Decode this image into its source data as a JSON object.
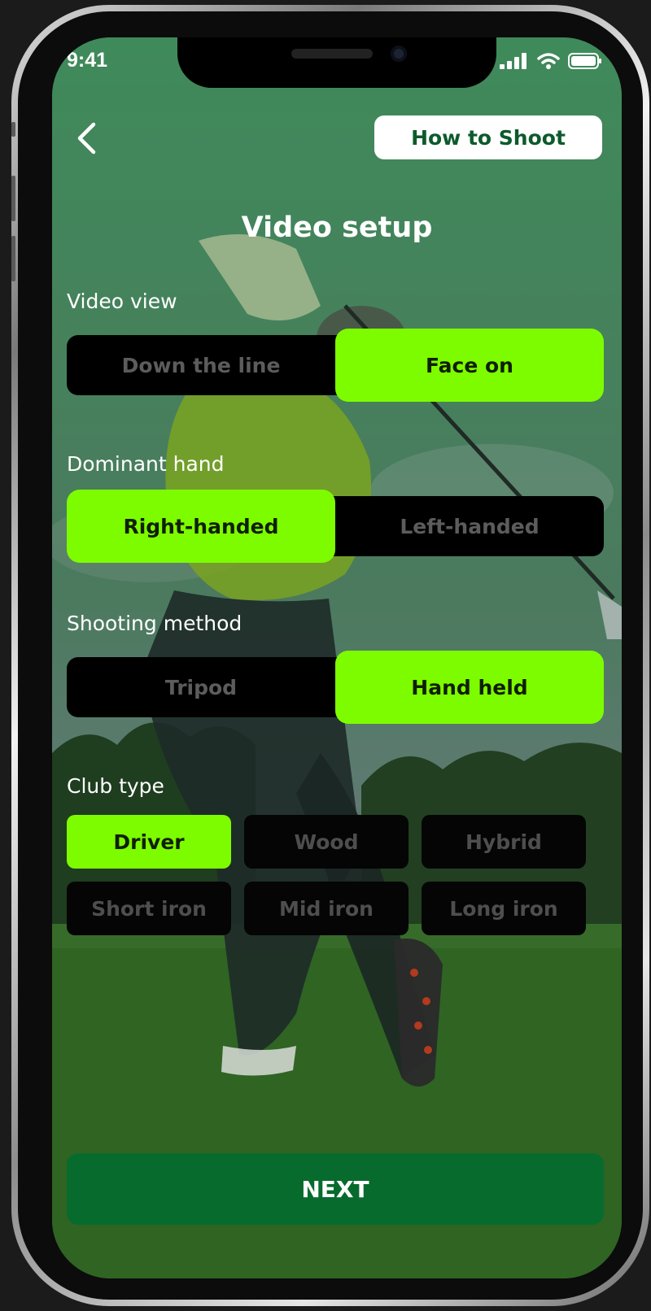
{
  "status": {
    "time": "9:41"
  },
  "header": {
    "how_to_label": "How to Shoot"
  },
  "page": {
    "title": "Video setup"
  },
  "video_view": {
    "label": "Video view",
    "options": [
      "Down the line",
      "Face on"
    ],
    "selected": "Face on"
  },
  "dominant_hand": {
    "label": "Dominant hand",
    "options": [
      "Right-handed",
      "Left-handed"
    ],
    "selected": "Right-handed"
  },
  "shooting_method": {
    "label": "Shooting method",
    "options": [
      "Tripod",
      "Hand held"
    ],
    "selected": "Hand held"
  },
  "club_type": {
    "label": "Club type",
    "options": [
      "Driver",
      "Wood",
      "Hybrid",
      "Short iron",
      "Mid iron",
      "Long iron"
    ],
    "selected": "Driver"
  },
  "footer": {
    "next_label": "NEXT"
  },
  "colors": {
    "accent": "#7dfc00",
    "primary_button": "#086b2e",
    "segment_bg": "#000000",
    "overlay_green": "#3a6b4c"
  }
}
